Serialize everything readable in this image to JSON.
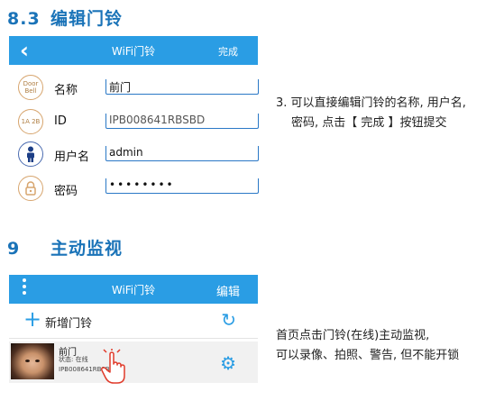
{
  "section1": {
    "number": "8.3",
    "title": "编辑门铃"
  },
  "screen1": {
    "header_title": "WiFi门铃",
    "header_action": "完成",
    "back_icon": "chevron-left-icon",
    "fields": [
      {
        "icon_text": "Door Bell",
        "label": "名称",
        "value": "前门"
      },
      {
        "icon_text": "1A 2B",
        "label": "ID",
        "value": "IPB008641RBSBD"
      },
      {
        "icon_text": "",
        "label": "用户名",
        "value": "admin"
      },
      {
        "icon_text": "",
        "label": "密码",
        "value": "••••••••"
      }
    ]
  },
  "description1": {
    "line1": "3. 可以直接编辑门铃的名称, 用户名,",
    "line2": "密码, 点击【 完成 】按钮提交"
  },
  "section2": {
    "number": "9",
    "title": "主动监视"
  },
  "screen2": {
    "header_title": "WiFi门铃",
    "header_action": "编辑",
    "add_label": "新增门铃",
    "device": {
      "name": "前门",
      "status": "状态:  在线",
      "id": "IPB008641RBSBD"
    }
  },
  "description2": {
    "line1": "首页点击门铃(在线)主动监视,",
    "line2": "可以录像、拍照、警告, 但不能开锁"
  },
  "colors": {
    "accent": "#2a9de4",
    "heading": "#1a73b8",
    "field_underline": "#2a78c6"
  }
}
